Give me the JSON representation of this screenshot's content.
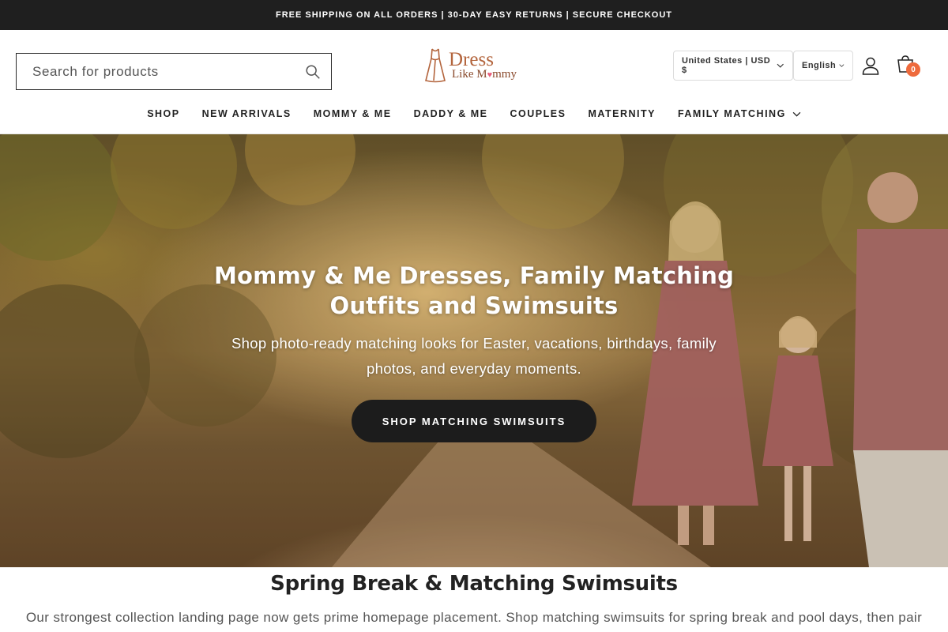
{
  "announcement": {
    "text": "FREE SHIPPING ON ALL ORDERS | 30-DAY EASY RETURNS | SECURE CHECKOUT"
  },
  "header": {
    "search": {
      "placeholder": "Search for products",
      "value": ""
    },
    "logo": {
      "line1": "Dress",
      "line2_a": "Like M",
      "line2_heart": "♥",
      "line2_b": "mmy"
    },
    "country_selector": "United States | USD $",
    "language_selector": "English",
    "cart_count": "0"
  },
  "nav": {
    "items": [
      {
        "label": "SHOP"
      },
      {
        "label": "NEW ARRIVALS"
      },
      {
        "label": "MOMMY & ME"
      },
      {
        "label": "DADDY & ME"
      },
      {
        "label": "COUPLES"
      },
      {
        "label": "MATERNITY"
      },
      {
        "label": "FAMILY MATCHING"
      }
    ]
  },
  "hero": {
    "title": "Mommy & Me Dresses, Family Matching Outfits and Swimsuits",
    "subtitle": "Shop photo-ready matching looks for Easter, vacations, birthdays, family photos, and everyday moments.",
    "cta_label": "SHOP MATCHING SWIMSUITS"
  },
  "section": {
    "title": "Spring Break & Matching Swimsuits",
    "text": "Our strongest collection landing page now gets prime homepage placement. Shop matching swimsuits for spring break and pool days, then pair"
  },
  "icons": {
    "search": "search-icon",
    "account": "account-icon",
    "cart": "cart-icon",
    "chevron": "chevron-down-icon"
  },
  "colors": {
    "announcement_bg": "#1f1f1f",
    "cart_badge": "#ee6a3c",
    "cta_bg": "#1c1c1c",
    "logo_brown": "#b3643c"
  }
}
